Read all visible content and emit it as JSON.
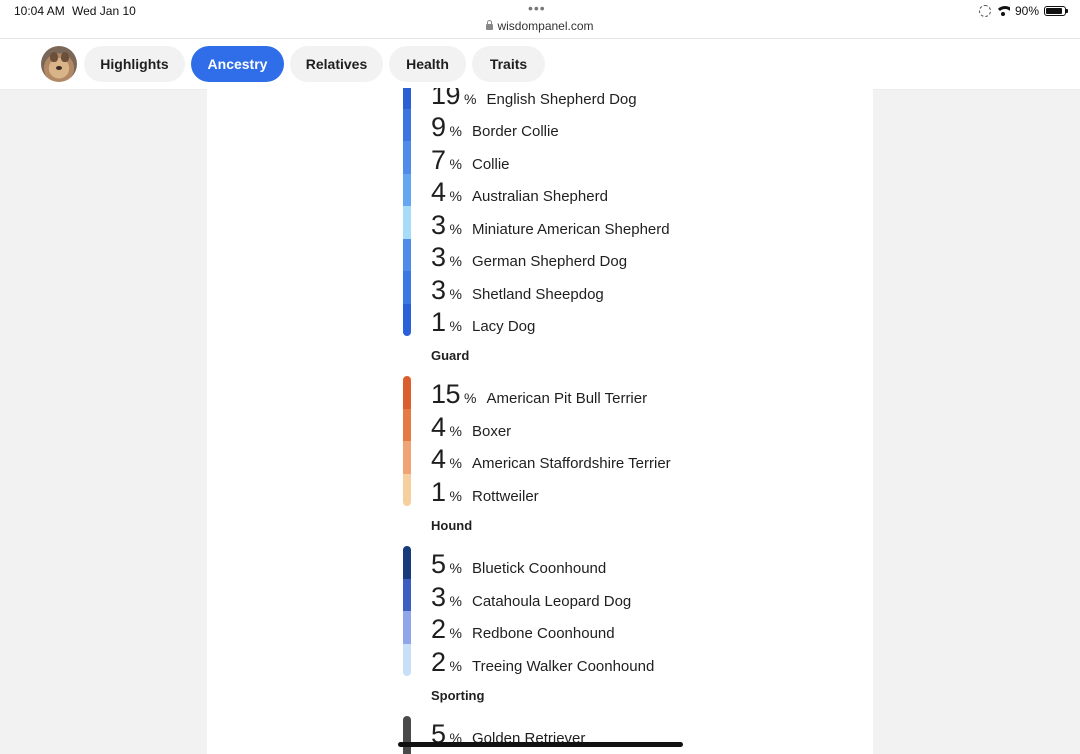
{
  "status_bar": {
    "time": "10:04 AM",
    "date": "Wed Jan 10",
    "url": "wisdompanel.com",
    "battery": "90%"
  },
  "tabs": [
    {
      "label": "Highlights"
    },
    {
      "label": "Ancestry",
      "active": true
    },
    {
      "label": "Relatives"
    },
    {
      "label": "Health"
    },
    {
      "label": "Traits"
    }
  ],
  "groups": [
    {
      "label": "",
      "breeds": [
        {
          "pct": "19",
          "name": "English Shepherd Dog"
        },
        {
          "pct": "9",
          "name": "Border Collie"
        },
        {
          "pct": "7",
          "name": "Collie"
        },
        {
          "pct": "4",
          "name": "Australian Shepherd"
        },
        {
          "pct": "3",
          "name": "Miniature American Shepherd"
        },
        {
          "pct": "3",
          "name": "German Shepherd Dog"
        },
        {
          "pct": "3",
          "name": "Shetland Sheepdog"
        },
        {
          "pct": "1",
          "name": "Lacy Dog"
        }
      ]
    },
    {
      "label": "Guard",
      "breeds": [
        {
          "pct": "15",
          "name": "American Pit Bull Terrier"
        },
        {
          "pct": "4",
          "name": "Boxer"
        },
        {
          "pct": "4",
          "name": "American Staffordshire Terrier"
        },
        {
          "pct": "1",
          "name": "Rottweiler"
        }
      ]
    },
    {
      "label": "Hound",
      "breeds": [
        {
          "pct": "5",
          "name": "Bluetick Coonhound"
        },
        {
          "pct": "3",
          "name": "Catahoula Leopard Dog"
        },
        {
          "pct": "2",
          "name": "Redbone Coonhound"
        },
        {
          "pct": "2",
          "name": "Treeing Walker Coonhound"
        }
      ]
    },
    {
      "label": "Sporting",
      "breeds": [
        {
          "pct": "5",
          "name": "Golden Retriever"
        }
      ]
    }
  ],
  "percent_sign": "%",
  "colors": {
    "accent": "#2f6ee8",
    "herding_bar": [
      "#2a5fd6",
      "#3c74e2",
      "#4f8cea",
      "#64a6f0",
      "#86c8f5",
      "#a6dcf8",
      "#3a79e3",
      "#2a61d8"
    ],
    "guard_bar": [
      "#d9602e",
      "#e57a45",
      "#f0a374",
      "#f5cf9e"
    ],
    "hound_bar": [
      "#173a7a",
      "#3b5ec0",
      "#8fa6e8",
      "#c7e0f7"
    ],
    "sporting_bar": [
      "#4a4a4a"
    ]
  }
}
